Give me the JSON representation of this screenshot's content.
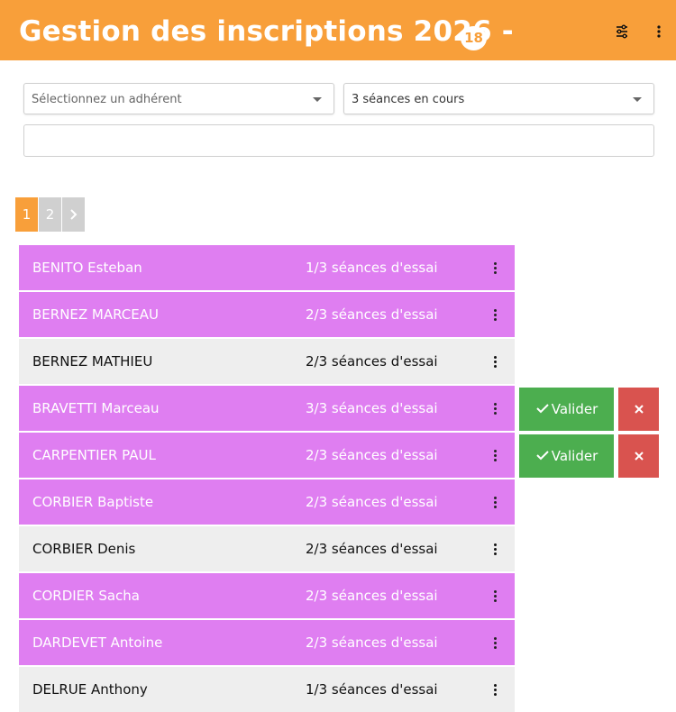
{
  "header": {
    "title": "Gestion des inscriptions 2026 -",
    "count": "18",
    "filter_icon": "sliders-icon",
    "more_icon": "vertical-ellipsis-icon",
    "background": "#f89f3a"
  },
  "filters": {
    "member_select": {
      "placeholder": "Sélectionnez un adhérent"
    },
    "session_select": {
      "value": "3 séances en cours"
    },
    "search_value": ""
  },
  "pagination": {
    "pages": [
      "1",
      "2"
    ],
    "current": "1",
    "next_icon": "chevron-right-icon"
  },
  "actions": {
    "validate_label": "Valider",
    "validate_icon": "check-icon",
    "reject_icon": "close-icon"
  },
  "rows": [
    {
      "name": "BENITO Esteban",
      "status": "1/3 séances d'essai",
      "style": "purple"
    },
    {
      "name": "BERNEZ MARCEAU",
      "status": "2/3 séances d'essai",
      "style": "purple"
    },
    {
      "name": "BERNEZ MATHIEU",
      "status": "2/3 séances d'essai",
      "style": "grey"
    },
    {
      "name": "BRAVETTI Marceau",
      "status": "3/3 séances d'essai",
      "style": "purple"
    },
    {
      "name": "CARPENTIER PAUL",
      "status": "2/3 séances d'essai",
      "style": "purple"
    },
    {
      "name": "CORBIER Baptiste",
      "status": "2/3 séances d'essai",
      "style": "purple"
    },
    {
      "name": "CORBIER Denis",
      "status": "2/3 séances d'essai",
      "style": "grey"
    },
    {
      "name": "CORDIER Sacha",
      "status": "2/3 séances d'essai",
      "style": "purple"
    },
    {
      "name": "DARDEVET Antoine",
      "status": "2/3 séances d'essai",
      "style": "purple"
    },
    {
      "name": "DELRUE Anthony",
      "status": "1/3 séances d'essai",
      "style": "grey"
    }
  ],
  "colors": {
    "purple_row": "#df7ef1",
    "grey_row": "#eeeeee",
    "validate": "#4cae4f",
    "reject": "#d9534f"
  }
}
